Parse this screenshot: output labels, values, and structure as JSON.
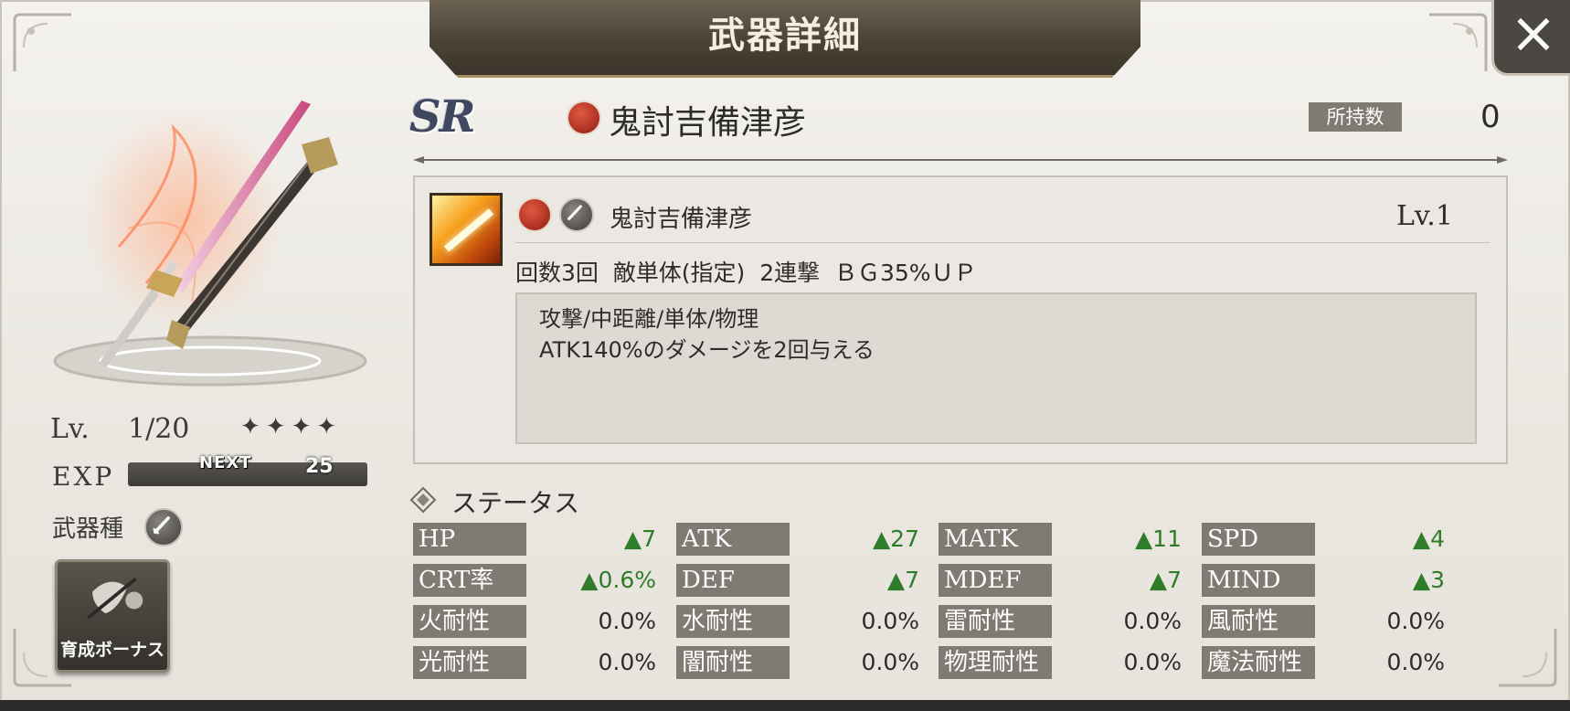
{
  "header": {
    "title": "武器詳細",
    "close_icon": "close-icon"
  },
  "weapon": {
    "rarity": "SR",
    "element_icon": "fire-element-icon",
    "name": "鬼討吉備津彦",
    "owned_label": "所持数",
    "owned_count": "0"
  },
  "left": {
    "lv_label": "Lv.",
    "lv_value": "1/20",
    "stars": "✦✦✦✦",
    "exp_label": "EXP",
    "next_label": "NEXT",
    "next_value": "25",
    "exp_progress": 0,
    "weapon_type_label": "武器種",
    "bonus_button_label": "育成ボーナス"
  },
  "skill": {
    "name": "鬼討吉備津彦",
    "level": "Lv.1",
    "summary": "回数3回  敵単体(指定)  2連撃  ＢＧ35%ＵＰ",
    "desc_line1": "攻撃/中距離/単体/物理",
    "desc_line2": "ATK140%のダメージを2回与える"
  },
  "status": {
    "title": "ステータス",
    "rows": [
      [
        {
          "label": "HP",
          "value": "▲7",
          "up": true
        },
        {
          "label": "ATK",
          "value": "▲27",
          "up": true
        },
        {
          "label": "MATK",
          "value": "▲11",
          "up": true
        },
        {
          "label": "SPD",
          "value": "▲4",
          "up": true
        }
      ],
      [
        {
          "label": "CRT率",
          "value": "▲0.6%",
          "up": true
        },
        {
          "label": "DEF",
          "value": "▲7",
          "up": true
        },
        {
          "label": "MDEF",
          "value": "▲7",
          "up": true
        },
        {
          "label": "MIND",
          "value": "▲3",
          "up": true
        }
      ],
      [
        {
          "label": "火耐性",
          "value": "0.0%",
          "up": false
        },
        {
          "label": "水耐性",
          "value": "0.0%",
          "up": false
        },
        {
          "label": "雷耐性",
          "value": "0.0%",
          "up": false
        },
        {
          "label": "風耐性",
          "value": "0.0%",
          "up": false
        }
      ],
      [
        {
          "label": "光耐性",
          "value": "0.0%",
          "up": false
        },
        {
          "label": "闇耐性",
          "value": "0.0%",
          "up": false
        },
        {
          "label": "物理耐性",
          "value": "0.0%",
          "up": false
        },
        {
          "label": "魔法耐性",
          "value": "0.0%",
          "up": false
        }
      ]
    ]
  },
  "colors": {
    "stat_up": "#2f7d2a",
    "label_bg": "#7f7a72",
    "header_bg": "#4a4336",
    "exp_fill": "#e7b341"
  }
}
